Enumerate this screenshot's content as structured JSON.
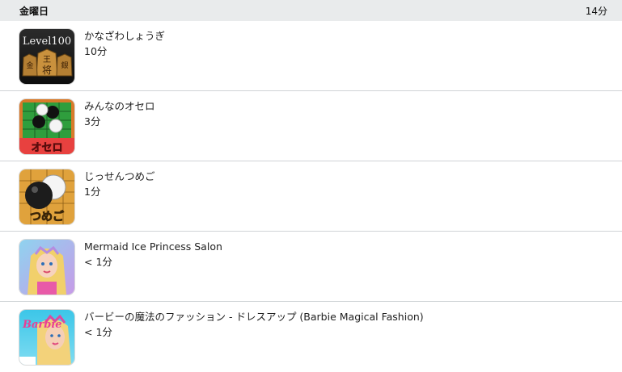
{
  "header": {
    "day": "金曜日",
    "total": "14分"
  },
  "apps": [
    {
      "name": "かなざわしょうぎ",
      "time": "10分",
      "icon": "kanazawa-shogi-icon",
      "icon_text": "Level100"
    },
    {
      "name": "みんなのオセロ",
      "time": "3分",
      "icon": "minna-no-othello-icon",
      "icon_text": "オセロ"
    },
    {
      "name": "じっせんつめご",
      "time": "1分",
      "icon": "jissen-tsumego-icon",
      "icon_text": "つめご"
    },
    {
      "name": "Mermaid Ice Princess Salon",
      "time": "< 1分",
      "icon": "mermaid-princess-icon"
    },
    {
      "name": "バービーの魔法のファッション - ドレスアップ (Barbie Magical Fashion)",
      "time": "< 1分",
      "icon": "barbie-fashion-icon",
      "icon_text": "Barbie"
    }
  ],
  "colors": {
    "header_bg": "#e9ebec",
    "divider": "#cfd3d6"
  }
}
